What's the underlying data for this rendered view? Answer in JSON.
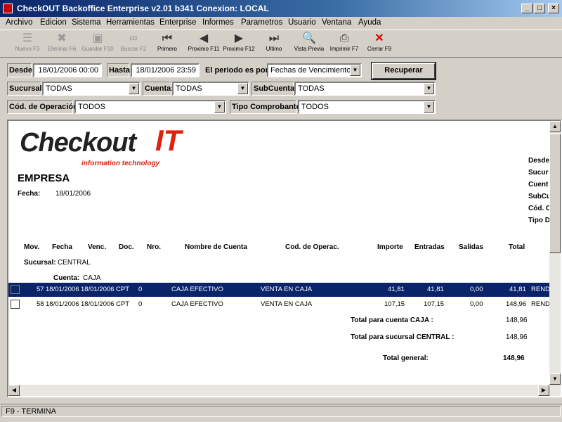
{
  "window": {
    "title": "CheckOUT Backoffice Enterprise v2.01 b341 Conexion: LOCAL",
    "minimize": "_",
    "maximize": "□",
    "close": "×"
  },
  "menu": [
    "Archivo",
    "Edicion",
    "Sistema",
    "Herramientas",
    "Enterprise",
    "Informes",
    "Parametros",
    "Usuario",
    "Ventana",
    "Ayuda"
  ],
  "toolbar": [
    {
      "label": "Nuevo F3",
      "icon": "new-icon",
      "glyph": "☰",
      "enabled": false
    },
    {
      "label": "Eliminar F6",
      "icon": "delete-icon",
      "glyph": "✖",
      "enabled": false
    },
    {
      "label": "Guardar F10",
      "icon": "save-icon",
      "glyph": "▣",
      "enabled": false
    },
    {
      "label": "Buscar F2",
      "icon": "binoculars-icon",
      "glyph": "∞",
      "enabled": false
    },
    {
      "label": "Primero",
      "icon": "first-icon",
      "glyph": "⏮",
      "enabled": true
    },
    {
      "label": "Proximo F11",
      "icon": "prev-icon",
      "glyph": "◀",
      "enabled": true
    },
    {
      "label": "Proximo F12",
      "icon": "next-icon",
      "glyph": "▶",
      "enabled": true
    },
    {
      "label": "Ultimo",
      "icon": "last-icon",
      "glyph": "⏭",
      "enabled": true
    },
    {
      "label": "Vista Previa",
      "icon": "preview-icon",
      "glyph": "🔍",
      "enabled": true
    },
    {
      "label": "Imprimir F7",
      "icon": "printer-icon",
      "glyph": "⎙",
      "enabled": true
    },
    {
      "label": "Cerrar F9",
      "icon": "close-x-icon",
      "glyph": "✕",
      "enabled": true
    }
  ],
  "filters": {
    "desde_label": "Desde:",
    "desde_value": "18/01/2006 00:00",
    "hasta_label": "Hasta:",
    "hasta_value": "18/01/2006 23:59",
    "periodo_label": "El periodo es por:",
    "periodo_value": "Fechas de Vencimiento",
    "recuperar": "Recuperar",
    "sucursal_label": "Sucursal:",
    "sucursal_value": "TODAS",
    "cuenta_label": "Cuenta:",
    "cuenta_value": "TODAS",
    "subcuenta_label": "SubCuenta:",
    "subcuenta_value": "TODAS",
    "codop_label": "Cód. de Operación:",
    "codop_value": "TODOS",
    "tipocomp_label": "Tipo Comprobante:",
    "tipocomp_value": "TODOS"
  },
  "report": {
    "logo_main": "Checkout",
    "logo_it": "IT",
    "logo_sub": "information technology",
    "empresa": "EMPRESA",
    "fecha_label": "Fecha:",
    "fecha_value": "18/01/2006",
    "right_labels": [
      "Desde",
      "Sucur",
      "Cuent",
      "SubCu",
      "Cód. C",
      "Tipo D"
    ],
    "columns": [
      "Mov.",
      "Fecha",
      "Venc.",
      "Doc.",
      "Nro.",
      "Nombre de Cuenta",
      "Cod. de Operac.",
      "Importe",
      "Entradas",
      "Salidas",
      "Total"
    ],
    "sucursal_label": "Sucursal:",
    "sucursal_value": "CENTRAL",
    "cuenta_label": "Cuenta:",
    "cuenta_value": "CAJA",
    "rows": [
      {
        "mov": "57",
        "fecha": "18/01/2006",
        "venc": "18/01/2006",
        "doc": "CPT",
        "nro": "0",
        "cuenta": "CAJA EFECTIVO",
        "codop": "VENTA EN CAJA",
        "importe": "41,81",
        "entradas": "41,81",
        "salidas": "0,00",
        "total": "41,81",
        "extra": "RENDI",
        "selected": true
      },
      {
        "mov": "58",
        "fecha": "18/01/2006",
        "venc": "18/01/2006",
        "doc": "CPT",
        "nro": "0",
        "cuenta": "CAJA EFECTIVO",
        "codop": "VENTA EN CAJA",
        "importe": "107,15",
        "entradas": "107,15",
        "salidas": "0,00",
        "total": "148,96",
        "extra": "RENDI",
        "selected": false
      }
    ],
    "total_cuenta_label": "Total para cuenta CAJA :",
    "total_cuenta_value": "148,96",
    "total_sucursal_label": "Total para sucursal CENTRAL :",
    "total_sucursal_value": "148,96",
    "total_general_label": "Total general:",
    "total_general_value": "148,96"
  },
  "status": "F9 - TERMINA"
}
